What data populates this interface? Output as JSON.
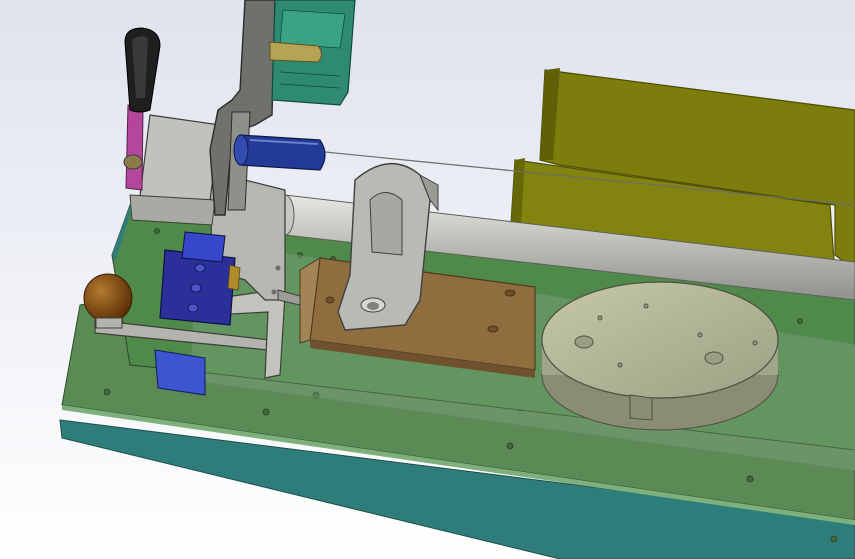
{
  "scene": {
    "kind": "cad-3d-viewport",
    "subject": "fixture-assembly",
    "visible_text": []
  },
  "colors": {
    "background_top": "#dfe3ee",
    "background_bottom": "#ffffff",
    "base_plate": "#5b8a55",
    "base_plate_edge": "#2f7d7a",
    "top_plate": "#4f8a4b",
    "steel": "#b9bab3",
    "steel_dark": "#7f817b",
    "olive_block": "#7c7d0d",
    "olive_edge": "#606003",
    "wood_block": "#8f6d3f",
    "blue_block": "#2a2f9a",
    "light_blue_block": "#3747c9",
    "dark_handle": "#1f1f1f",
    "magenta_rod": "#b3479c",
    "blue_cylinder": "#233b96",
    "teal_block": "#2f8a72",
    "brown_knob": "#7b4309",
    "beige_disc": "#b3b596"
  },
  "parts": [
    {
      "name": "base-plate-icon"
    },
    {
      "name": "top-plate-icon"
    },
    {
      "name": "guide-rod-icon"
    },
    {
      "name": "rod-clamp-icon"
    },
    {
      "name": "slider-block-icon"
    },
    {
      "name": "rotary-disc-icon"
    },
    {
      "name": "olive-blocks-icon"
    },
    {
      "name": "toggle-handle-icon"
    },
    {
      "name": "lever-arm-icon"
    },
    {
      "name": "blue-cylinder-icon"
    },
    {
      "name": "teal-block-icon"
    },
    {
      "name": "knob-icon"
    },
    {
      "name": "blue-block-icon"
    }
  ]
}
